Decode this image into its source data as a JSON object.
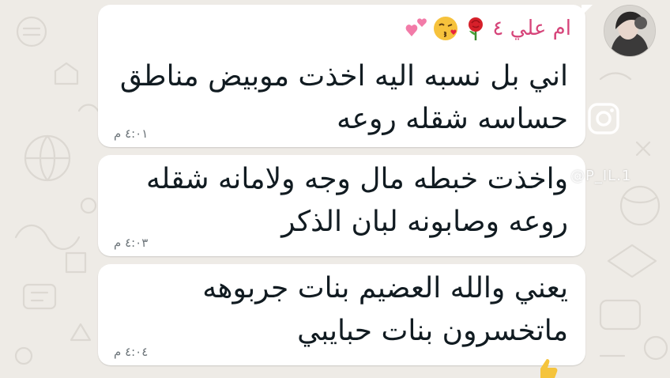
{
  "chat": {
    "avatar_icon": "user-avatar",
    "sender": {
      "name": "ام علي ٤",
      "emojis": [
        "rose-icon",
        "kissing-face-icon",
        "two-hearts-icon"
      ],
      "name_color": "#d6457a"
    },
    "messages": [
      {
        "lines": [
          "اني بل نسبه اليه اخذت موبيض مناطق",
          "حساسه  شقله روعه"
        ],
        "time": "٤:٠١ م"
      },
      {
        "lines": [
          "واخذت خبطه مال وجه ولامانه شقله",
          "روعه وصابونه لبان الذكر"
        ],
        "time": "٤:٠٣ م"
      },
      {
        "lines": [
          "يعني والله العضيم بنات جربوهه",
          "ماتخسرون  بنات حبايبي"
        ],
        "time": "٤:٠٤ م"
      }
    ]
  },
  "overlay": {
    "instagram_icon": "instagram-icon",
    "watermark": "@P_IL.1"
  },
  "colors": {
    "background": "#eeebe6",
    "bubble": "#ffffff",
    "text": "#111b21",
    "time": "#6c7479"
  }
}
